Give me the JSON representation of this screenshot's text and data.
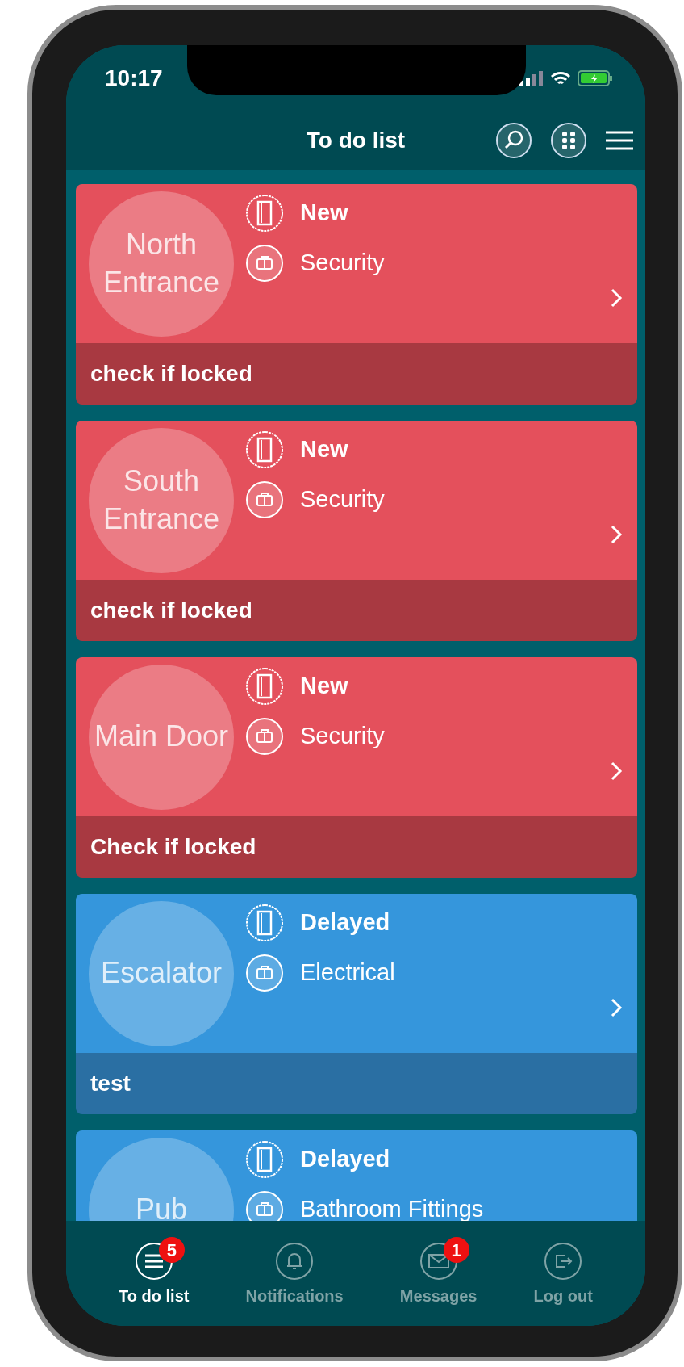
{
  "status_bar": {
    "time": "10:17"
  },
  "header": {
    "title": "To do list"
  },
  "tasks": [
    {
      "location": "North Entrance",
      "status": "New",
      "category": "Security",
      "note": "check if locked",
      "kind": "new"
    },
    {
      "location": "South Entrance",
      "status": "New",
      "category": "Security",
      "note": "check if locked",
      "kind": "new"
    },
    {
      "location": "Main Door",
      "status": "New",
      "category": "Security",
      "note": "Check if locked",
      "kind": "new"
    },
    {
      "location": "Escalator",
      "status": "Delayed",
      "category": "Electrical",
      "note": "test",
      "kind": "delayed"
    },
    {
      "location": "Pub",
      "status": "Delayed",
      "category": "Bathroom Fittings",
      "kind": "delayed"
    }
  ],
  "tab_bar": [
    {
      "label": "To do list",
      "badge": "5",
      "selected": true
    },
    {
      "label": "Notifications",
      "selected": false
    },
    {
      "label": "Messages",
      "badge": "1",
      "selected": false
    },
    {
      "label": "Log out",
      "selected": false
    }
  ]
}
